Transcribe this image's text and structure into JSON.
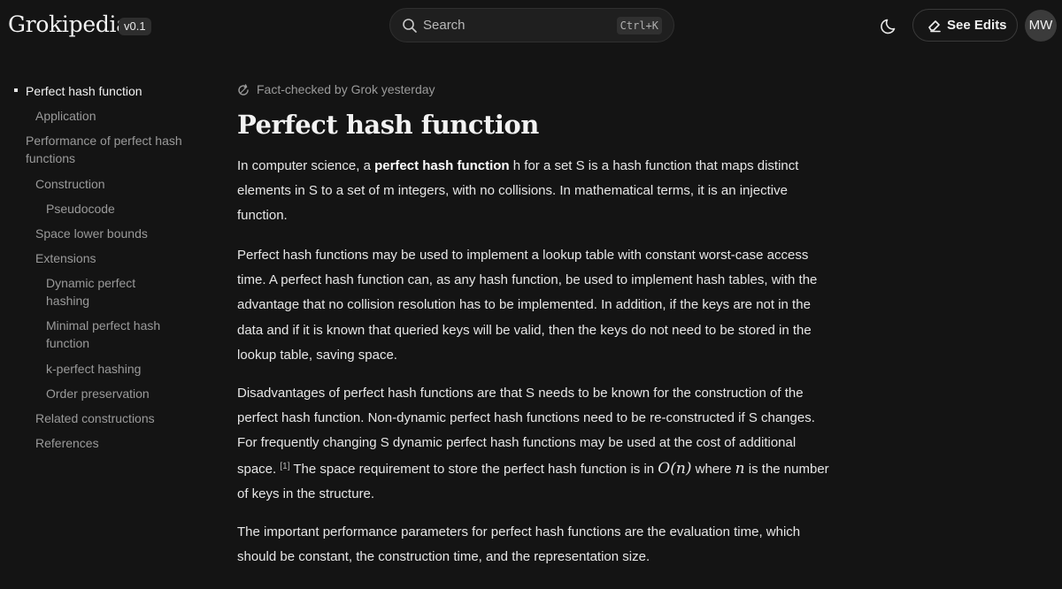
{
  "header": {
    "logo": "Grokipedia",
    "version": "v0.1",
    "search_placeholder": "Search",
    "search_shortcut": "Ctrl+K",
    "see_edits_label": "See Edits",
    "avatar_initials": "MW"
  },
  "toc": {
    "items": [
      {
        "label": "Perfect hash function",
        "active": true
      },
      {
        "label": "Application"
      },
      {
        "label": "Performance of perfect hash functions"
      },
      {
        "label": "Construction"
      },
      {
        "label": "Pseudocode"
      },
      {
        "label": "Space lower bounds"
      },
      {
        "label": "Extensions"
      },
      {
        "label": "Dynamic perfect hashing"
      },
      {
        "label": "Minimal perfect hash function"
      },
      {
        "label": "k-perfect hashing"
      },
      {
        "label": "Order preservation"
      },
      {
        "label": "Related constructions"
      },
      {
        "label": "References"
      }
    ]
  },
  "article": {
    "fact_checked": "Fact-checked by Grok yesterday",
    "title": "Perfect hash function",
    "p1_before": "In computer science, a ",
    "p1_bold": "perfect hash function",
    "p1_after": " h for a set S is a hash function that maps distinct elements in S to a set of m integers, with no collisions. In mathematical terms, it is an injective function.",
    "p2": "Perfect hash functions may be used to implement a lookup table with constant worst-case access time. A perfect hash function can, as any hash function, be used to implement hash tables, with the advantage that no collision resolution has to be implemented. In addition, if the keys are not in the data and if it is known that queried keys will be valid, then the keys do not need to be stored in the lookup table, saving space.",
    "p3_a": "Disadvantages of perfect hash functions are that S needs to be known for the construction of the perfect hash function. Non-dynamic perfect hash functions need to be re-constructed if S changes. For frequently changing S dynamic perfect hash functions may be used at the cost of additional space.",
    "p3_ref": "[1]",
    "p3_b": " The space requirement to store the perfect hash function is in ",
    "p3_math1": "O(n)",
    "p3_c": " where ",
    "p3_math2": "n",
    "p3_d": " is the number of keys in the structure.",
    "p4": "The important performance parameters for perfect hash functions are the evaluation time, which should be constant, the construction time, and the representation size."
  }
}
